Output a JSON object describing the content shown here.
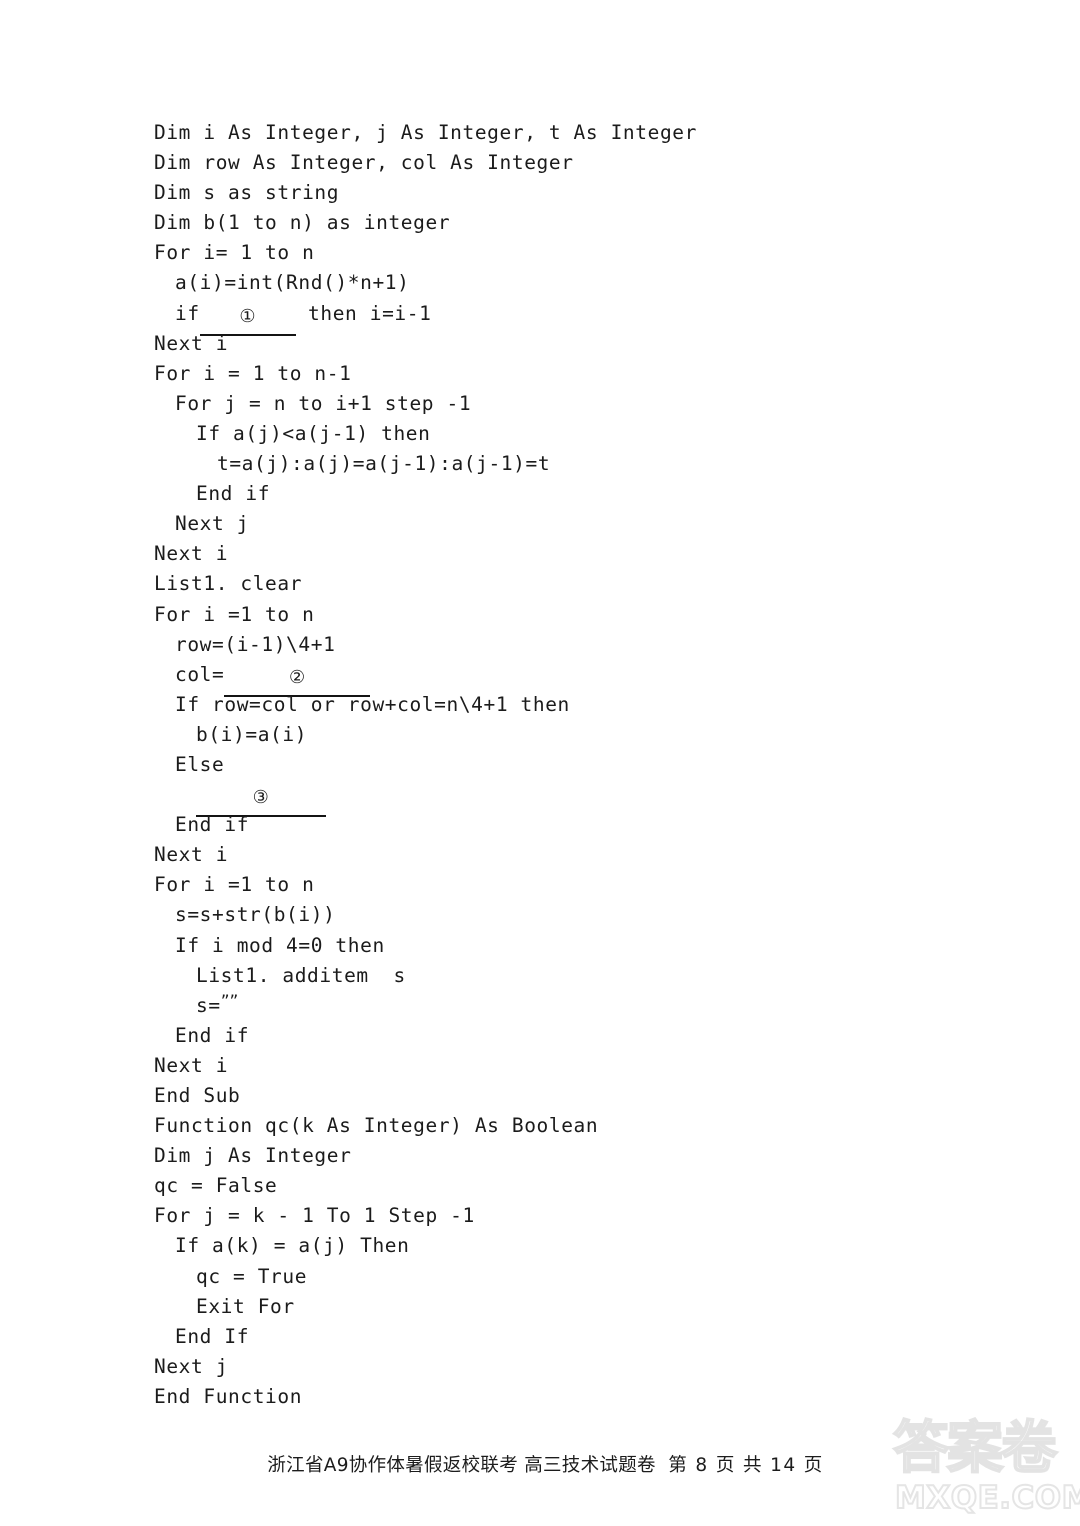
{
  "document": {
    "type": "exam-paper-scan",
    "background_color": "#ffffff",
    "text_color": "#1a1a1a"
  },
  "code": {
    "language": "Visual Basic",
    "lines": [
      {
        "indent": 0,
        "text": "Dim i As Integer, j As Integer, t As Integer"
      },
      {
        "indent": 0,
        "text": "Dim row As Integer, col As Integer"
      },
      {
        "indent": 0,
        "text": "Dim s as string"
      },
      {
        "indent": 0,
        "text": "Dim b(1 to n) as integer"
      },
      {
        "indent": 0,
        "text": "For i= 1 to n"
      },
      {
        "indent": 1,
        "text": "a(i)=int(Rnd()*n+1)"
      },
      {
        "indent": 1,
        "text": "if",
        "blank": "blank-1",
        "blank_label": "①",
        "text_after": " then i=i-1"
      },
      {
        "indent": 0,
        "text": "Next i"
      },
      {
        "indent": 0,
        "text": "For i = 1 to n-1"
      },
      {
        "indent": 1,
        "text": "For j = n to i+1 step -1"
      },
      {
        "indent": 2,
        "text": "If a(j)<a(j-1) then"
      },
      {
        "indent": 3,
        "text": "t=a(j):a(j)=a(j-1):a(j-1)=t"
      },
      {
        "indent": 2,
        "text": "End if"
      },
      {
        "indent": 1,
        "text": "Next j"
      },
      {
        "indent": 0,
        "text": "Next i"
      },
      {
        "indent": 0,
        "text": "List1. clear"
      },
      {
        "indent": 0,
        "text": "For i =1 to n"
      },
      {
        "indent": 1,
        "text": "row=(i-1)\\4+1"
      },
      {
        "indent": 1,
        "text": "col=",
        "blank": "blank-2",
        "blank_label": "②",
        "text_after": ""
      },
      {
        "indent": 1,
        "text": "If row=col or row+col=n\\4+1 then"
      },
      {
        "indent": 2,
        "text": "b(i)=a(i)"
      },
      {
        "indent": 1,
        "text": "Else"
      },
      {
        "indent": 2,
        "text": "",
        "blank": "blank-3",
        "blank_label": "③",
        "text_after": ""
      },
      {
        "indent": 1,
        "text": "End if"
      },
      {
        "indent": 0,
        "text": "Next i"
      },
      {
        "indent": 0,
        "text": "For i =1 to n"
      },
      {
        "indent": 1,
        "text": "s=s+str(b(i))"
      },
      {
        "indent": 1,
        "text": "If i mod 4=0 then"
      },
      {
        "indent": 2,
        "text": "List1. additem  s"
      },
      {
        "indent": 2,
        "text": "s=",
        "quote": "””"
      },
      {
        "indent": 1,
        "text": "End if"
      },
      {
        "indent": 0,
        "text": "Next i"
      },
      {
        "indent": 0,
        "text": "End Sub"
      },
      {
        "indent": 0,
        "text": "Function qc(k As Integer) As Boolean"
      },
      {
        "indent": 0,
        "text": "Dim j As Integer"
      },
      {
        "indent": 0,
        "text": "qc = False"
      },
      {
        "indent": 0,
        "text": "For j = k - 1 To 1 Step -1"
      },
      {
        "indent": 1,
        "text": "If a(k) = a(j) Then"
      },
      {
        "indent": 2,
        "text": "qc = True"
      },
      {
        "indent": 2,
        "text": "Exit For"
      },
      {
        "indent": 1,
        "text": "End If"
      },
      {
        "indent": 0,
        "text": "Next j"
      },
      {
        "indent": 0,
        "text": "End Function"
      }
    ]
  },
  "blanks": [
    {
      "id": "blank-1",
      "label": "①"
    },
    {
      "id": "blank-2",
      "label": "②"
    },
    {
      "id": "blank-3",
      "label": "③"
    }
  ],
  "footer": {
    "exam_title": "浙江省A9协作体暑假返校联考",
    "paper_name": "高三技术试题卷",
    "page_info": "第 8 页 共 14 页",
    "page_number": "8",
    "total_pages": "14"
  },
  "watermark": {
    "chinese": "答案卷",
    "latin": "MXQE.COM",
    "color": "#e5e5e5"
  }
}
